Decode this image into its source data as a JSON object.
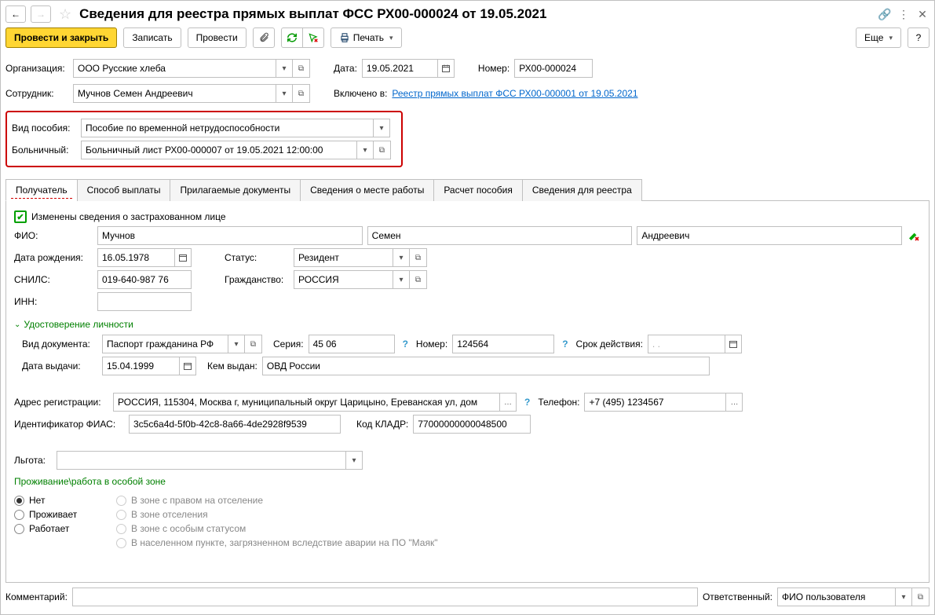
{
  "title": "Сведения для реестра прямых выплат ФСС РХ00-000024 от 19.05.2021",
  "toolbar": {
    "post_close": "Провести и закрыть",
    "save": "Записать",
    "post": "Провести",
    "print": "Печать",
    "more": "Еще"
  },
  "header": {
    "org_label": "Организация:",
    "org_value": "ООО Русские хлеба",
    "date_label": "Дата:",
    "date_value": "19.05.2021",
    "number_label": "Номер:",
    "number_value": "РХ00-000024",
    "employee_label": "Сотрудник:",
    "employee_value": "Мучнов Семен Андреевич",
    "included_in_label": "Включено в:",
    "included_in_link": "Реестр прямых выплат ФСС РХ00-000001 от 19.05.2021"
  },
  "benefit": {
    "type_label": "Вид пособия:",
    "type_value": "Пособие по временной нетрудоспособности",
    "sicklist_label": "Больничный:",
    "sicklist_value": "Больничный лист РХ00-000007 от 19.05.2021 12:00:00"
  },
  "tabs": [
    "Получатель",
    "Способ выплаты",
    "Прилагаемые документы",
    "Сведения о месте работы",
    "Расчет пособия",
    "Сведения для реестра"
  ],
  "recipient": {
    "changed_label": "Изменены сведения о застрахованном лице",
    "fio_label": "ФИО:",
    "last": "Мучнов",
    "first": "Семен",
    "middle": "Андреевич",
    "dob_label": "Дата рождения:",
    "dob": "16.05.1978",
    "status_label": "Статус:",
    "status": "Резидент",
    "snils_label": "СНИЛС:",
    "snils": "019-640-987 76",
    "citizenship_label": "Гражданство:",
    "citizenship": "РОССИЯ",
    "inn_label": "ИНН:",
    "inn": ""
  },
  "identity": {
    "section": "Удостоверение личности",
    "doc_type_label": "Вид документа:",
    "doc_type": "Паспорт гражданина РФ",
    "series_label": "Серия:",
    "series": "45 06",
    "number_label": "Номер:",
    "number": "124564",
    "validity_label": "Срок действия:",
    "validity": "  .  .    ",
    "issue_date_label": "Дата выдачи:",
    "issue_date": "15.04.1999",
    "issued_by_label": "Кем выдан:",
    "issued_by": "ОВД России"
  },
  "address": {
    "reg_label": "Адрес регистрации:",
    "reg_value": "РОССИЯ, 115304, Москва г, муниципальный округ Царицыно, Ереванская ул, дом",
    "phone_label": "Телефон:",
    "phone": "+7 (495) 1234567",
    "fias_label": "Идентификатор ФИАС:",
    "fias": "3c5c6a4d-5f0b-42c8-8a66-4de2928f9539",
    "kladr_label": "Код КЛАДР:",
    "kladr": "77000000000048500"
  },
  "benefit_code": {
    "label": "Льгота:"
  },
  "zone": {
    "section": "Проживание\\работа в особой зоне",
    "left": [
      "Нет",
      "Проживает",
      "Работает"
    ],
    "right": [
      "В зоне с правом на отселение",
      "В зоне отселения",
      "В зоне с особым статусом",
      "В населенном пункте, загрязненном вследствие аварии на ПО \"Маяк\""
    ]
  },
  "footer": {
    "comment_label": "Комментарий:",
    "responsible_label": "Ответственный:",
    "responsible_value": "ФИО пользователя"
  }
}
